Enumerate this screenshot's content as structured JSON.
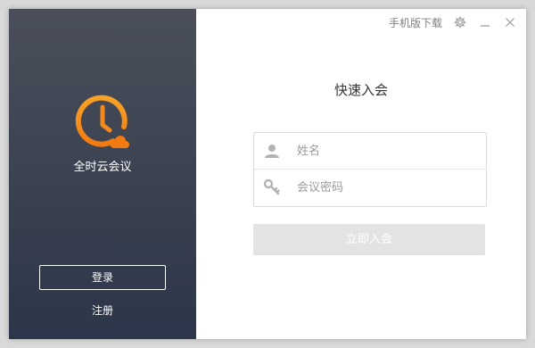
{
  "sidebar": {
    "app_name": "全时云会议",
    "login_label": "登录",
    "register_label": "注册"
  },
  "topbar": {
    "mobile_download_label": "手机版下载",
    "icons": [
      "gear-icon",
      "minimize-icon",
      "close-icon"
    ]
  },
  "main": {
    "title": "快速入会",
    "name_placeholder": "姓名",
    "name_value": "",
    "password_placeholder": "会议密码",
    "password_value": "",
    "join_label": "立即入会"
  },
  "colors": {
    "accent": "#f7931e",
    "sidebar_top": "#4a4f5a",
    "sidebar_bottom": "#2c364a",
    "join_disabled": "#e3e3e3"
  }
}
